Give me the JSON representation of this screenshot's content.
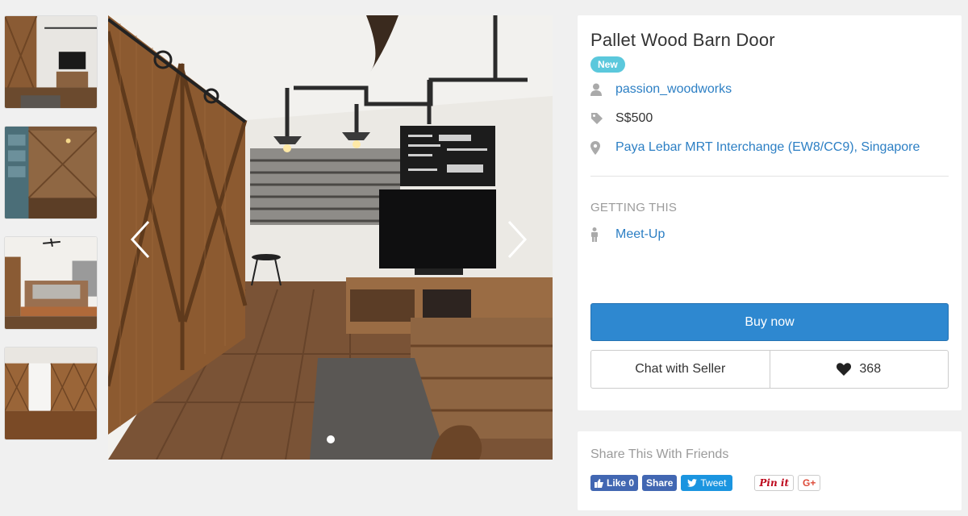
{
  "listing": {
    "title": "Pallet Wood Barn Door",
    "condition_badge": "New",
    "seller": "passion_woodworks",
    "price": "S$500",
    "location": "Paya Lebar MRT Interchange (EW8/CC9), Singapore"
  },
  "getting_this": {
    "label": "GETTING THIS",
    "method": "Meet-Up"
  },
  "actions": {
    "buy_label": "Buy now",
    "chat_label": "Chat with Seller",
    "like_count": "368"
  },
  "share": {
    "title": "Share This With Friends",
    "fb_like": "Like 0",
    "fb_share": "Share",
    "tweet": "Tweet",
    "pinterest": "Pin it",
    "gplus": "G+"
  },
  "gallery": {
    "thumbnail_count": 4,
    "active_slide": 0,
    "slide_count": 1
  },
  "colors": {
    "accent_blue": "#2e88d0",
    "link_blue": "#2c7fc4",
    "badge_teal": "#5bc8dc",
    "muted_text": "#9b9b9b"
  },
  "icons": {
    "seller": "user-icon",
    "price": "tag-icon",
    "location": "map-pin-icon",
    "delivery": "person-icon",
    "like": "heart-icon",
    "prev": "chevron-left-icon",
    "next": "chevron-right-icon"
  }
}
